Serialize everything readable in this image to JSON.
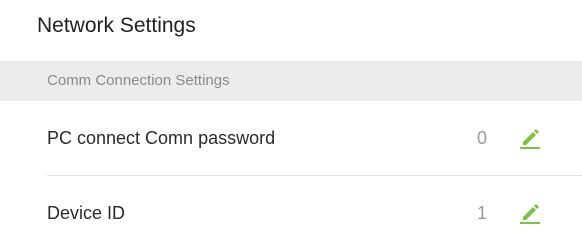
{
  "page": {
    "title": "Network Settings"
  },
  "section": {
    "label": "Comm Connection Settings"
  },
  "rows": [
    {
      "label": "PC connect Comn password",
      "value": "0",
      "icon": "pencil-edit-icon"
    },
    {
      "label": "Device ID",
      "value": "1",
      "icon": "pencil-edit-icon"
    }
  ],
  "colors": {
    "accent": "#7dc242",
    "section_bg": "#ececec"
  }
}
